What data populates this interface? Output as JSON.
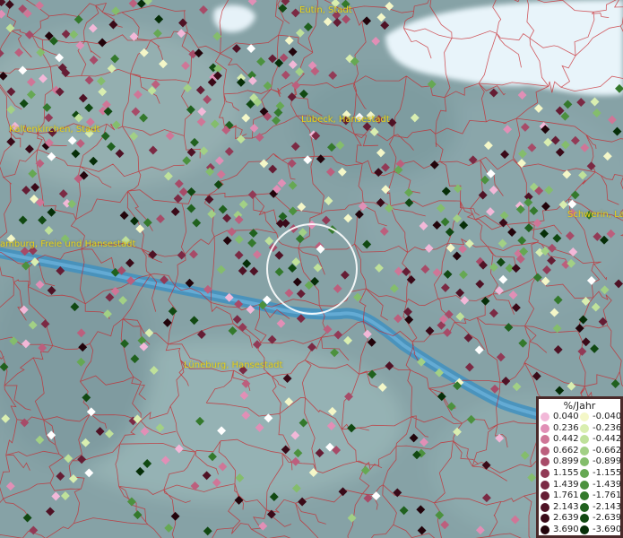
{
  "places": [
    {
      "id": "eutin",
      "label": "Eutin, Stadt"
    },
    {
      "id": "kaltenkirchen",
      "label": "Kaltenkirchen, Stadt"
    },
    {
      "id": "luebeck",
      "label": "Lübeck, Hansestadt"
    },
    {
      "id": "schwerin",
      "label": "Schwerin, La"
    },
    {
      "id": "hamburg",
      "label": "amburg, Freie und Hansestadt"
    },
    {
      "id": "lueneburg",
      "label": "Lüneburg, Hansestadt"
    }
  ],
  "legend": {
    "title": "%/Jahr",
    "positive": [
      {
        "label": "0.040",
        "color": "#f2b8d8"
      },
      {
        "label": "0.236",
        "color": "#e18fb6"
      },
      {
        "label": "0.442",
        "color": "#cf7697"
      },
      {
        "label": "0.662",
        "color": "#bc5f7d"
      },
      {
        "label": "0.899",
        "color": "#a74b68"
      },
      {
        "label": "1.155",
        "color": "#923a56"
      },
      {
        "label": "1.439",
        "color": "#7b2a44"
      },
      {
        "label": "1.761",
        "color": "#651d34"
      },
      {
        "label": "2.143",
        "color": "#4f1225"
      },
      {
        "label": "2.639",
        "color": "#3a0a18"
      },
      {
        "label": "3.690",
        "color": "#22040b"
      }
    ],
    "negative": [
      {
        "label": "-0.040",
        "color": "#f4f7c8"
      },
      {
        "label": "-0.236",
        "color": "#d9eeb0"
      },
      {
        "label": "-0.442",
        "color": "#bfe19a"
      },
      {
        "label": "-0.662",
        "color": "#a2d085"
      },
      {
        "label": "-0.899",
        "color": "#84bd6c"
      },
      {
        "label": "-1.155",
        "color": "#66a853"
      },
      {
        "label": "-1.439",
        "color": "#4c913e"
      },
      {
        "label": "-1.761",
        "color": "#34792c"
      },
      {
        "label": "-2.143",
        "color": "#20611e"
      },
      {
        "label": "-2.639",
        "color": "#114912"
      },
      {
        "label": "-3.690",
        "color": "#062e08"
      }
    ]
  },
  "colors": {
    "land": "#8ea8ac",
    "water": "#3d8fc0",
    "sea": "#e8f4fa",
    "border": "#c8242a",
    "label": "#e8d21a",
    "highlight": "#ffffff",
    "white_point": "#ffffff"
  }
}
